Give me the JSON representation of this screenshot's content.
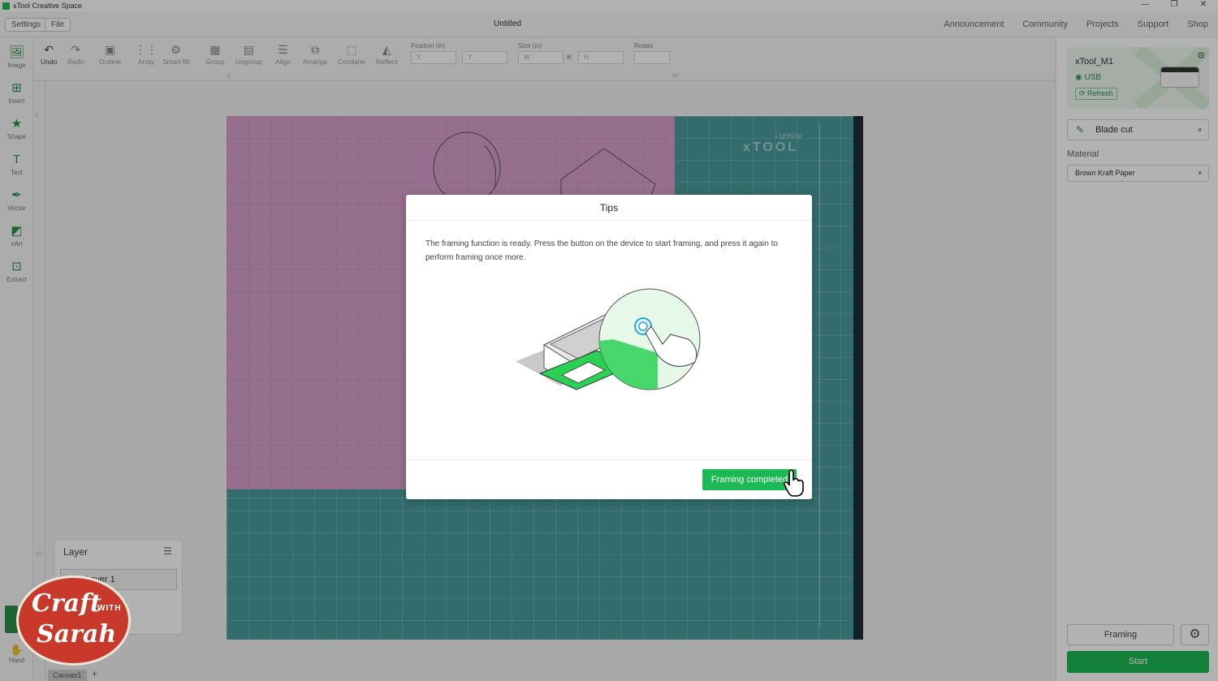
{
  "app": {
    "title": "xTool Creative Space",
    "window_controls": [
      "—",
      "❐",
      "✕"
    ]
  },
  "menubar": {
    "settings": "Settings",
    "file": "File",
    "doc_title": "Untitled",
    "nav": [
      "Announcement",
      "Community",
      "Projects",
      "Support",
      "Shop"
    ]
  },
  "toolbar": {
    "tools": [
      {
        "label": "Undo",
        "icon": "undo-icon",
        "glyph": "↶",
        "active": true
      },
      {
        "label": "Redo",
        "icon": "redo-icon",
        "glyph": "↷"
      },
      {
        "label": "Outline",
        "icon": "outline-icon",
        "glyph": "▣"
      },
      {
        "label": "Array",
        "icon": "array-icon",
        "glyph": "⋮⋮"
      },
      {
        "label": "Smart fill",
        "icon": "smart-fill-icon",
        "glyph": "⚙"
      },
      {
        "label": "Group",
        "icon": "group-icon",
        "glyph": "▦"
      },
      {
        "label": "Ungroup",
        "icon": "ungroup-icon",
        "glyph": "▤"
      },
      {
        "label": "Align",
        "icon": "align-icon",
        "glyph": "☰"
      },
      {
        "label": "Arrange",
        "icon": "arrange-icon",
        "glyph": "⧉"
      },
      {
        "label": "Combine",
        "icon": "combine-icon",
        "glyph": "⬚"
      },
      {
        "label": "Reflect",
        "icon": "reflect-icon",
        "glyph": "◭"
      }
    ],
    "position_label": "Position (in)",
    "x_placeholder": "X",
    "y_placeholder": "Y",
    "size_label": "Size (in)",
    "w_placeholder": "W",
    "h_placeholder": "H",
    "rotate_label": "Rotate"
  },
  "leftbar": {
    "tools": [
      {
        "label": "Image",
        "icon": "image-icon",
        "glyph": "🖼"
      },
      {
        "label": "Insert",
        "icon": "insert-icon",
        "glyph": "⊞"
      },
      {
        "label": "Shape",
        "icon": "shape-icon",
        "glyph": "★"
      },
      {
        "label": "Text",
        "icon": "text-icon",
        "glyph": "T"
      },
      {
        "label": "Vector",
        "icon": "vector-icon",
        "glyph": "✒"
      },
      {
        "label": "xArt",
        "icon": "xart-icon",
        "glyph": "◩"
      },
      {
        "label": "Extract",
        "icon": "extract-icon",
        "glyph": "⊡"
      }
    ],
    "hand_label": "Hand"
  },
  "rulers": {
    "top_marks": [
      "0",
      "10"
    ],
    "left_marks": [
      "0",
      "10"
    ]
  },
  "mat": {
    "brand": "xTOOL",
    "sub": "LightGrip"
  },
  "right_panel": {
    "device_name": "xTool_M1",
    "connection": "USB",
    "refresh": "Refresh",
    "mode": "Blade cut",
    "material_label": "Material",
    "material": "Brown Kraft Paper",
    "framing": "Framing",
    "start": "Start"
  },
  "layer": {
    "title": "Layer",
    "row_label": "Layer 1"
  },
  "canvas_tabs": {
    "tab": "Canvas1",
    "add": "+"
  },
  "modal": {
    "title": "Tips",
    "body": "The framing function is ready. Press the button on the device to start framing, and press it again to perform framing once more.",
    "button": "Framing completed"
  },
  "logo": {
    "line1": "Craft",
    "with": "WITH",
    "line2": "Sarah"
  },
  "colors": {
    "accent": "#1db954",
    "mat": "#4a9b9b",
    "paper": "#d8a0cc",
    "logo": "#c8392b"
  }
}
